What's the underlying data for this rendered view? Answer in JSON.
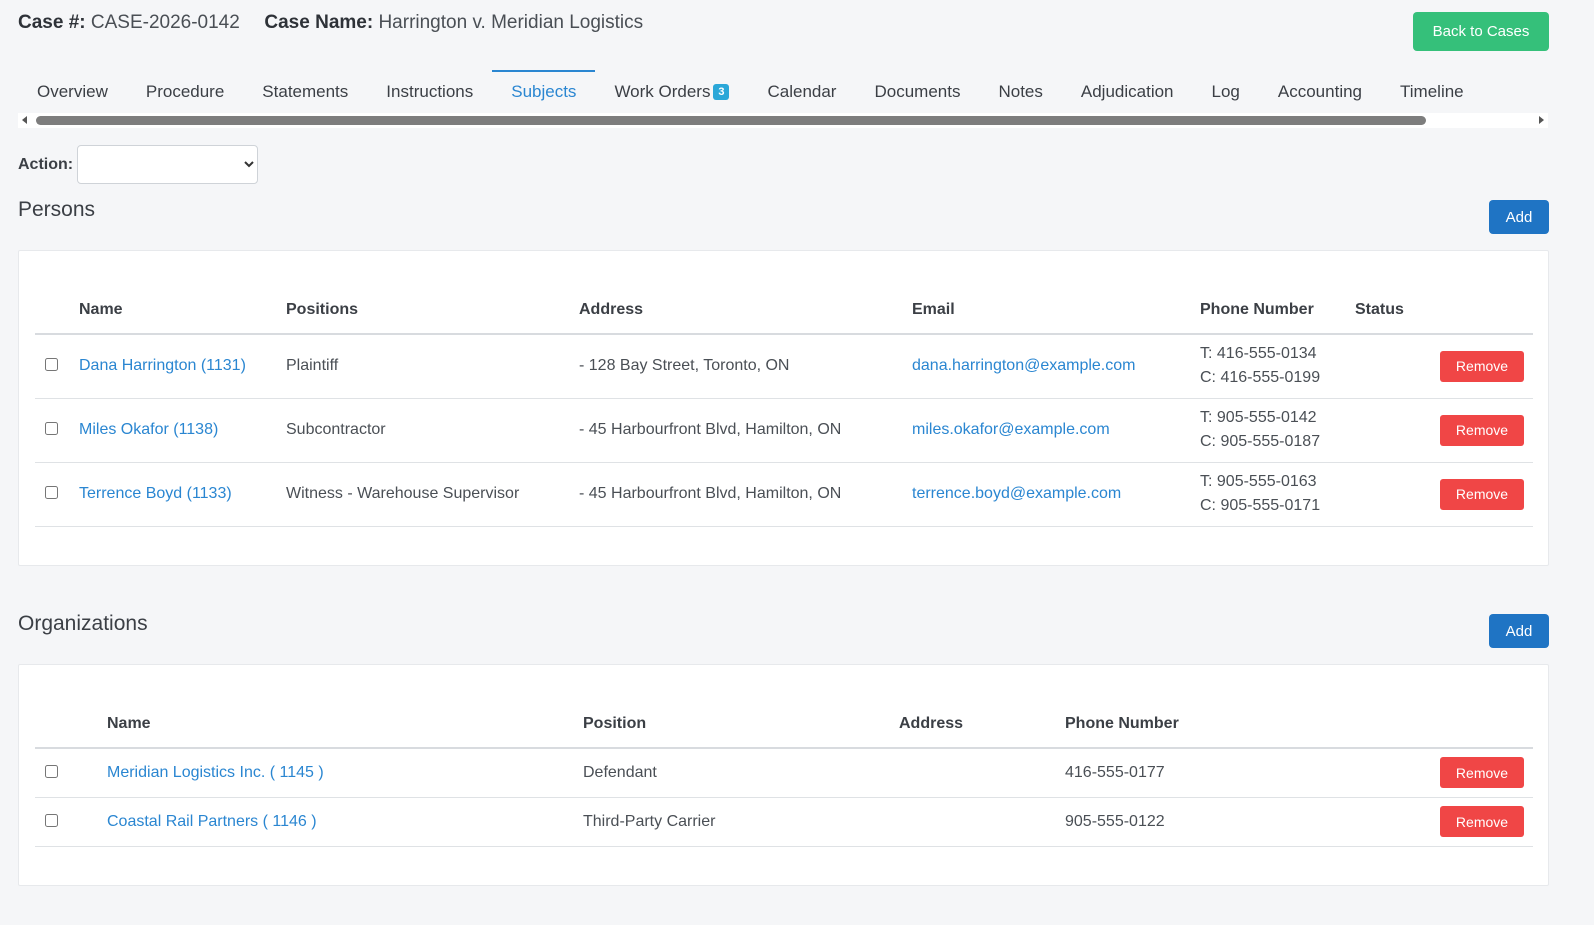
{
  "header": {
    "case_number_label": "Case #:",
    "case_number": "CASE-2026-0142",
    "case_name_label": "Case Name:",
    "case_name": "Harrington v. Meridian Logistics",
    "back_button": "Back to Cases"
  },
  "tabs": [
    {
      "label": "Overview"
    },
    {
      "label": "Procedure"
    },
    {
      "label": "Statements"
    },
    {
      "label": "Instructions"
    },
    {
      "label": "Subjects",
      "active": true
    },
    {
      "label": "Work Orders",
      "badge": "3"
    },
    {
      "label": "Calendar"
    },
    {
      "label": "Documents"
    },
    {
      "label": "Notes"
    },
    {
      "label": "Adjudication"
    },
    {
      "label": "Log"
    },
    {
      "label": "Accounting"
    },
    {
      "label": "Timeline"
    }
  ],
  "action": {
    "label": "Action:",
    "selected": ""
  },
  "persons": {
    "title": "Persons",
    "add_button": "Add",
    "columns": [
      "Name",
      "Positions",
      "Address",
      "Email",
      "Phone Number",
      "Status"
    ],
    "rows": [
      {
        "name": "Dana Harrington (1131)",
        "position": "Plaintiff",
        "address": "- 128 Bay Street, Toronto, ON",
        "email": "dana.harrington@example.com",
        "phone_t": "T: 416-555-0134",
        "phone_c": "C: 416-555-0199",
        "status": "",
        "remove": "Remove"
      },
      {
        "name": "Miles Okafor (1138)",
        "position": "Subcontractor",
        "address": "- 45 Harbourfront Blvd, Hamilton, ON",
        "email": "miles.okafor@example.com",
        "phone_t": "T: 905-555-0142",
        "phone_c": "C: 905-555-0187",
        "status": "",
        "remove": "Remove"
      },
      {
        "name": "Terrence Boyd (1133)",
        "position": "Witness - Warehouse Supervisor",
        "address": "- 45 Harbourfront Blvd, Hamilton, ON",
        "email": "terrence.boyd@example.com",
        "phone_t": "T: 905-555-0163",
        "phone_c": "C: 905-555-0171",
        "status": "",
        "remove": "Remove"
      }
    ]
  },
  "organizations": {
    "title": "Organizations",
    "add_button": "Add",
    "columns": [
      "Name",
      "Position",
      "Address",
      "Phone Number"
    ],
    "rows": [
      {
        "name": "Meridian Logistics Inc. ( 1145 )",
        "position": "Defendant",
        "address": "",
        "phone": "416-555-0177",
        "remove": "Remove"
      },
      {
        "name": "Coastal Rail Partners ( 1146 )",
        "position": "Third-Party Carrier",
        "address": "",
        "phone": "905-555-0122",
        "remove": "Remove"
      }
    ]
  },
  "colors": {
    "accent": "#2a86d1",
    "back_button": "#35c07a",
    "add_button": "#1f74c4",
    "remove_button": "#f04646",
    "badge": "#2aa7d8"
  }
}
